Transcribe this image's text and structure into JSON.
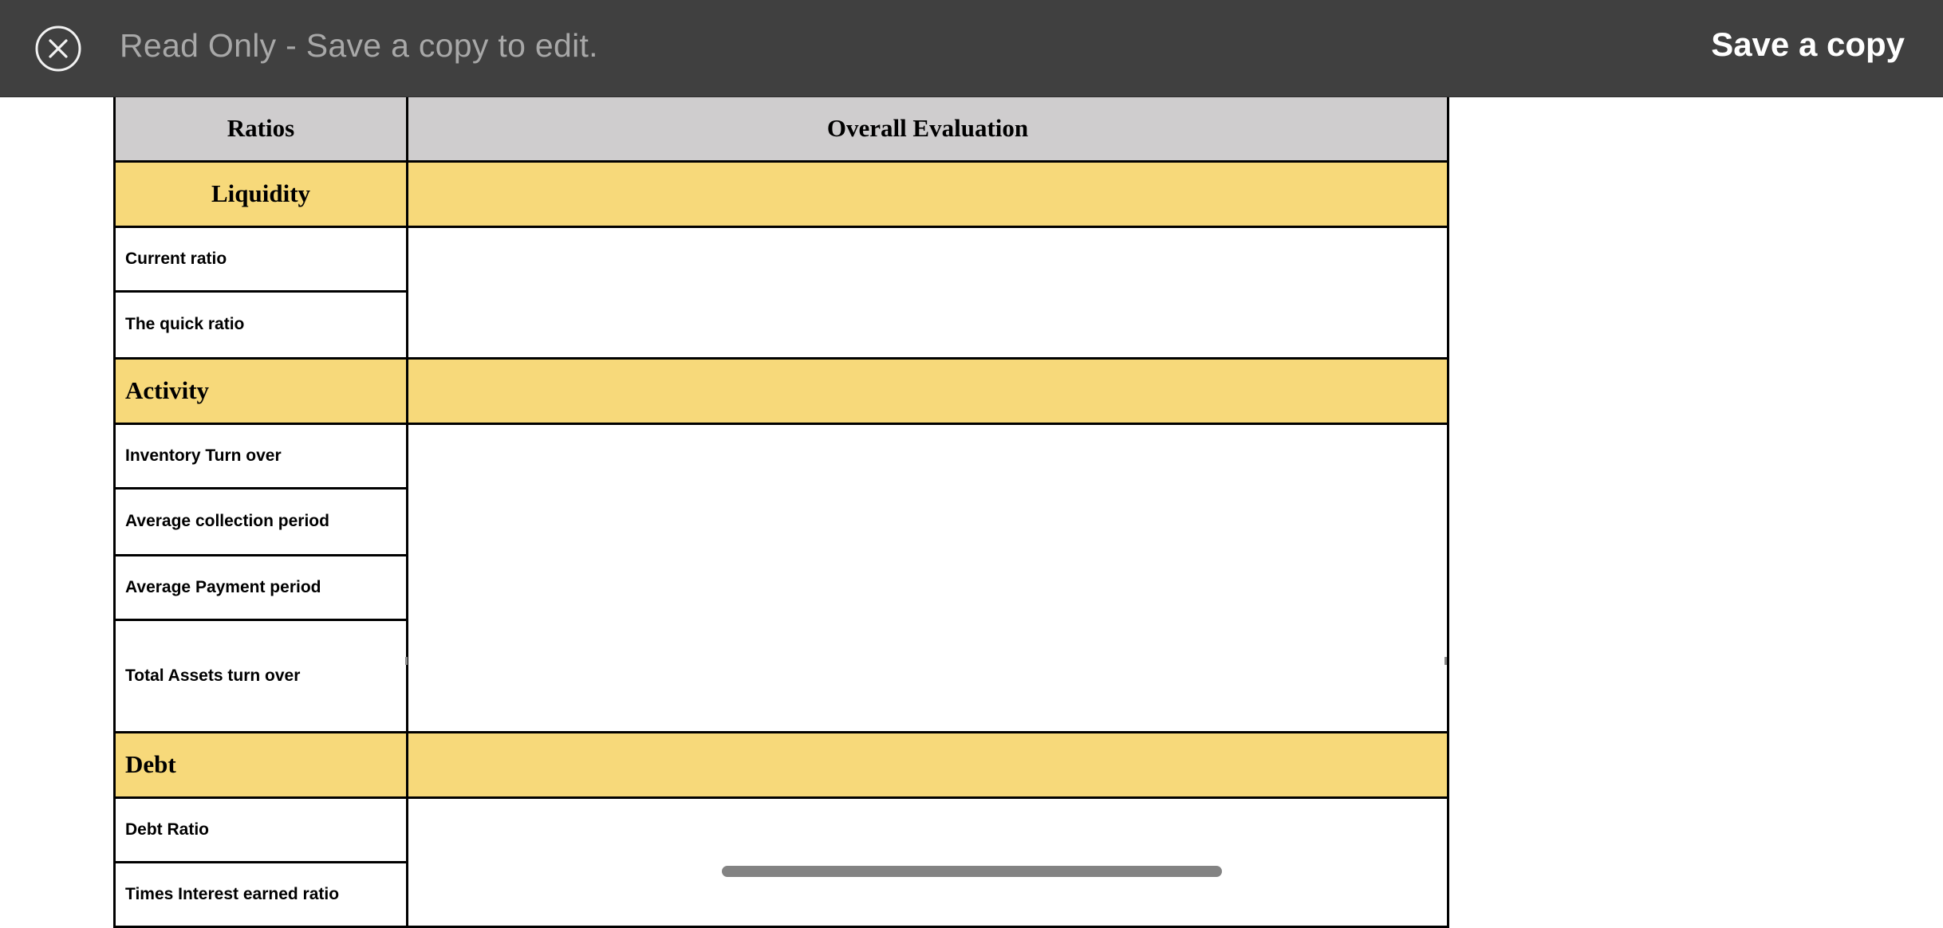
{
  "topbar": {
    "close_icon": "close-circle-icon",
    "status_text": "Read Only - Save a copy to edit.",
    "save_copy_label": "Save a copy"
  },
  "table": {
    "headers": [
      "Ratios",
      "Overall Evaluation"
    ],
    "sections": [
      {
        "category": "Liquidity",
        "items": [
          "Current ratio",
          "The quick ratio"
        ]
      },
      {
        "category": "Activity",
        "items": [
          "Inventory Turn over",
          "Average collection period",
          "Average Payment period",
          "Total Assets turn over"
        ]
      },
      {
        "category": "Debt",
        "items": [
          "Debt Ratio",
          "Times Interest earned ratio"
        ]
      }
    ]
  },
  "colors": {
    "topbar_bg": "#404040",
    "header_bg": "#cfcdce",
    "category_bg": "#f7d97a",
    "scrollbar": "#838383"
  }
}
